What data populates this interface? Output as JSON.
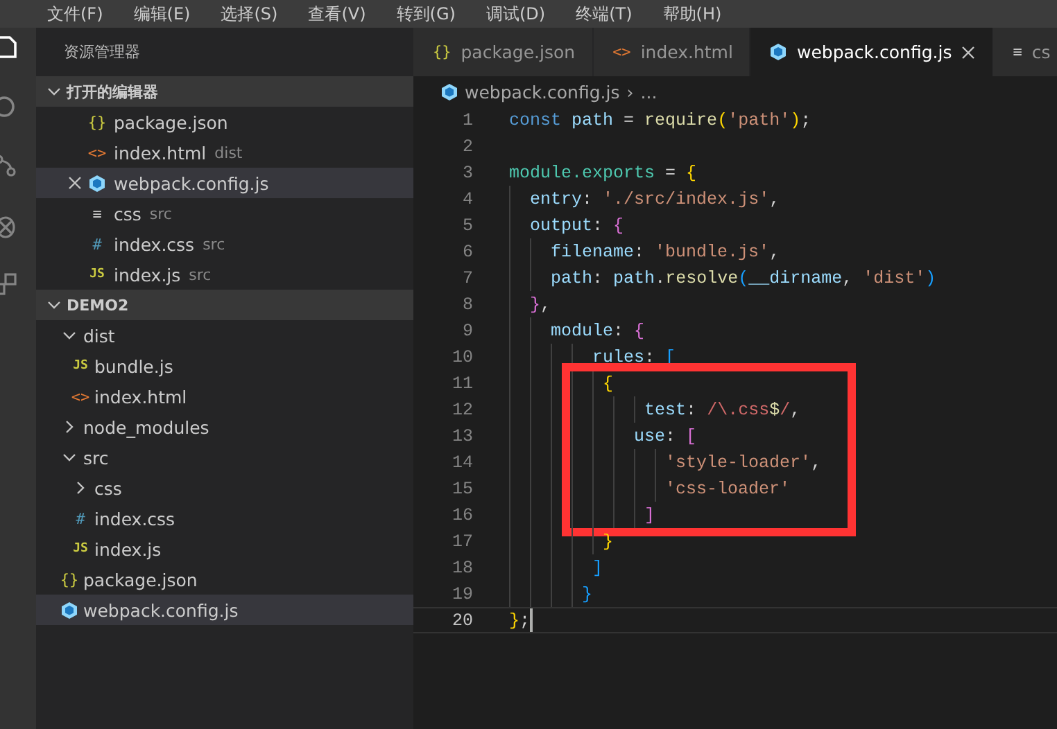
{
  "menu": [
    "文件(F)",
    "编辑(E)",
    "选择(S)",
    "查看(V)",
    "转到(G)",
    "调试(D)",
    "终端(T)",
    "帮助(H)"
  ],
  "activity_bar": [
    {
      "kind": "files",
      "selected": true
    },
    {
      "kind": "search",
      "selected": false
    },
    {
      "kind": "git",
      "selected": false
    },
    {
      "kind": "debug",
      "selected": false
    },
    {
      "kind": "extensions",
      "selected": false
    }
  ],
  "sidebar": {
    "title": "资源管理器",
    "open_editors": {
      "title": "打开的编辑器",
      "expanded": true,
      "items": [
        {
          "name": "package.json",
          "kind": "json",
          "icon_text": "{}",
          "selected": false
        },
        {
          "name": "index.html",
          "kind": "html",
          "icon_text": "<>",
          "description": "dist",
          "selected": false
        },
        {
          "name": "webpack.config.js",
          "kind": "webpack",
          "selected": true
        },
        {
          "name": "css",
          "kind": "text",
          "icon_text": "≡",
          "description": "src",
          "selected": false
        },
        {
          "name": "index.css",
          "kind": "css",
          "icon_text": "#",
          "description": "src",
          "selected": false
        },
        {
          "name": "index.js",
          "kind": "js",
          "icon_text": "JS",
          "description": "src",
          "selected": false
        }
      ]
    },
    "folder": {
      "title": "DEMO2",
      "expanded": true,
      "children": [
        {
          "name": "dist",
          "kind": "folder",
          "expanded": true,
          "children": [
            {
              "name": "bundle.js",
              "kind": "js",
              "icon_text": "JS",
              "selected": false
            },
            {
              "name": "index.html",
              "kind": "html",
              "icon_text": "<>",
              "selected": false
            }
          ]
        },
        {
          "name": "node_modules",
          "kind": "folder",
          "expanded": false
        },
        {
          "name": "src",
          "kind": "folder",
          "expanded": true,
          "children": [
            {
              "name": "css",
              "kind": "folder",
              "expanded": false
            },
            {
              "name": "index.css",
              "kind": "css",
              "icon_text": "#",
              "selected": false
            },
            {
              "name": "index.js",
              "kind": "js",
              "icon_text": "JS",
              "selected": false
            }
          ]
        },
        {
          "name": "package.json",
          "kind": "json",
          "icon_text": "{}",
          "selected": false
        },
        {
          "name": "webpack.config.js",
          "kind": "webpack",
          "selected": true
        }
      ]
    }
  },
  "tabs": [
    {
      "label": "package.json",
      "kind": "json",
      "icon_text": "{}",
      "selected": false
    },
    {
      "label": "index.html",
      "kind": "html",
      "icon_text": "<>",
      "selected": false
    },
    {
      "label": "webpack.config.js",
      "kind": "webpack",
      "selected": true
    },
    {
      "label": "cs",
      "kind": "text",
      "icon_text": "≡",
      "selected": false
    }
  ],
  "breadcrumb": {
    "file": "webpack.config.js",
    "kind": "webpack",
    "separator": "›",
    "more": "..."
  },
  "code": [
    {
      "highlighted": false,
      "lines": [
        {
          "number": "1",
          "current": false,
          "tokens": [
            {
              "kind": "kw",
              "text": "const"
            },
            {
              "kind": "var",
              "text": " path"
            },
            {
              "kind": "punct",
              "text": " = "
            },
            {
              "kind": "fn",
              "text": "require"
            },
            {
              "kind": "b1",
              "text": "("
            },
            {
              "kind": "str",
              "text": "'path'"
            },
            {
              "kind": "b1",
              "text": ")"
            },
            {
              "kind": "punct",
              "text": ";"
            }
          ]
        },
        {
          "number": "2",
          "current": false
        },
        {
          "number": "3",
          "current": false,
          "tokens": [
            {
              "kind": "teal",
              "text": "module.exports"
            },
            {
              "kind": "punct",
              "text": " = "
            },
            {
              "kind": "b1",
              "text": "{"
            }
          ]
        },
        {
          "number": "4",
          "current": false,
          "tokens": [
            {
              "kind": "prop",
              "text": "  entry"
            },
            {
              "kind": "punct",
              "text": ": "
            },
            {
              "kind": "str",
              "text": "'./src/index.js'"
            },
            {
              "kind": "punct",
              "text": ","
            }
          ]
        },
        {
          "number": "5",
          "current": false,
          "tokens": [
            {
              "kind": "prop",
              "text": "  output"
            },
            {
              "kind": "punct",
              "text": ": "
            },
            {
              "kind": "b2",
              "text": "{"
            }
          ]
        },
        {
          "number": "6",
          "current": false,
          "tokens": [
            {
              "kind": "prop",
              "text": "    filename"
            },
            {
              "kind": "punct",
              "text": ": "
            },
            {
              "kind": "str",
              "text": "'bundle.js'"
            },
            {
              "kind": "punct",
              "text": ","
            }
          ]
        },
        {
          "number": "7",
          "current": false,
          "tokens": [
            {
              "kind": "prop",
              "text": "    path"
            },
            {
              "kind": "punct",
              "text": ": "
            },
            {
              "kind": "var",
              "text": "path"
            },
            {
              "kind": "punct",
              "text": "."
            },
            {
              "kind": "fn",
              "text": "resolve"
            },
            {
              "kind": "b3",
              "text": "("
            },
            {
              "kind": "var",
              "text": "__dirname"
            },
            {
              "kind": "punct",
              "text": ", "
            },
            {
              "kind": "str",
              "text": "'dist'"
            },
            {
              "kind": "b3",
              "text": ")"
            }
          ]
        },
        {
          "number": "8",
          "current": false,
          "tokens": [
            {
              "kind": "b2",
              "text": "  }"
            },
            {
              "kind": "punct",
              "text": ","
            }
          ]
        },
        {
          "number": "9",
          "current": false,
          "tokens": [
            {
              "kind": "prop",
              "text": "    module"
            },
            {
              "kind": "punct",
              "text": ": "
            },
            {
              "kind": "b2",
              "text": "{"
            }
          ]
        },
        {
          "number": "10",
          "current": false,
          "tokens": [
            {
              "kind": "prop",
              "text": "        rules"
            },
            {
              "kind": "punct",
              "text": ": "
            },
            {
              "kind": "b3",
              "text": "["
            }
          ]
        }
      ]
    },
    {
      "highlighted": true,
      "lines": [
        {
          "number": "11",
          "current": false,
          "tokens": [
            {
              "kind": "b1",
              "text": "         {"
            }
          ]
        },
        {
          "number": "12",
          "current": false,
          "tokens": [
            {
              "kind": "prop",
              "text": "             test"
            },
            {
              "kind": "punct",
              "text": ": "
            },
            {
              "kind": "regex",
              "text": "/\\.css"
            },
            {
              "kind": "regexop",
              "text": "$"
            },
            {
              "kind": "regex",
              "text": "/"
            },
            {
              "kind": "punct",
              "text": ","
            }
          ]
        },
        {
          "number": "13",
          "current": false,
          "tokens": [
            {
              "kind": "prop",
              "text": "            use"
            },
            {
              "kind": "punct",
              "text": ": "
            },
            {
              "kind": "b2",
              "text": "["
            }
          ]
        },
        {
          "number": "14",
          "current": false,
          "tokens": [
            {
              "kind": "str",
              "text": "               'style-loader'"
            },
            {
              "kind": "punct",
              "text": ","
            }
          ]
        },
        {
          "number": "15",
          "current": false,
          "tokens": [
            {
              "kind": "str",
              "text": "               'css-loader'"
            }
          ]
        },
        {
          "number": "16",
          "current": false,
          "tokens": [
            {
              "kind": "b2",
              "text": "             ]"
            }
          ]
        }
      ]
    },
    {
      "highlighted": false,
      "lines": [
        {
          "number": "17",
          "current": false,
          "tokens": [
            {
              "kind": "b1",
              "text": "         }"
            }
          ]
        },
        {
          "number": "18",
          "current": false,
          "tokens": [
            {
              "kind": "b3",
              "text": "        ]"
            }
          ]
        },
        {
          "number": "19",
          "current": false,
          "tokens": [
            {
              "kind": "b3",
              "text": "       }"
            }
          ]
        },
        {
          "number": "20",
          "current": true,
          "tokens": [
            {
              "kind": "b1",
              "text": "}"
            },
            {
              "kind": "punct",
              "text": ";"
            }
          ]
        }
      ]
    }
  ]
}
